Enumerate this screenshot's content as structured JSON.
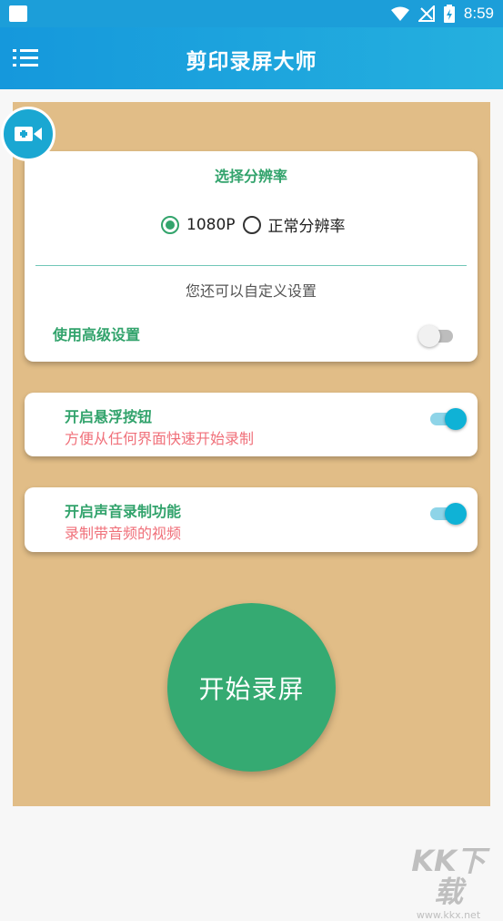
{
  "status": {
    "time": "8:59"
  },
  "app": {
    "title": "剪印录屏大师"
  },
  "resolution": {
    "title": "选择分辨率",
    "options": [
      {
        "label": "1080P",
        "selected": true
      },
      {
        "label": "正常分辨率",
        "selected": false
      }
    ],
    "custom_title": "您还可以自定义设置",
    "advanced_label": "使用高级设置",
    "advanced_enabled": false
  },
  "floating_button": {
    "title": "开启悬浮按钮",
    "subtitle": "方便从任何界面快速开始录制",
    "enabled": true
  },
  "audio_recording": {
    "title": "开启声音录制功能",
    "subtitle": "录制带音频的视频",
    "enabled": true
  },
  "start_button": {
    "label": "开始录屏"
  },
  "watermark": {
    "logo": "KK下载",
    "url": "www.kkx.net"
  },
  "colors": {
    "appbar": "#1c9ed9",
    "accent_green": "#32a36c",
    "panel_bg": "#e1bd87",
    "toggle_on": "#0fb2d6",
    "subtitle_pink": "#f0707a"
  }
}
